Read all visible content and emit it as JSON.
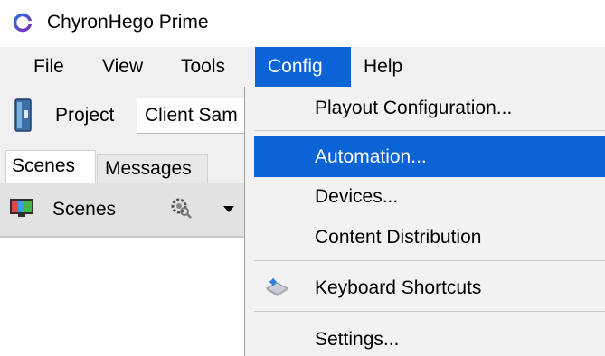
{
  "window": {
    "title": "ChyronHego Prime",
    "logo_icon": "chyronhego-logo-icon"
  },
  "menubar": {
    "items": [
      {
        "label": "File"
      },
      {
        "label": "View"
      },
      {
        "label": "Tools"
      },
      {
        "label": "Config",
        "open": true
      },
      {
        "label": "Help"
      }
    ]
  },
  "toolbar": {
    "project_label": "Project",
    "project_value": "Client Sam"
  },
  "tabs": [
    {
      "label": "Scenes",
      "active": true
    },
    {
      "label": "Messages",
      "active": false
    }
  ],
  "scenes_panel": {
    "label": "Scenes",
    "icons": [
      "scenes-icon",
      "gear-icon",
      "dropdown-arrow-icon"
    ]
  },
  "config_menu": {
    "items": [
      {
        "label": "Playout Configuration..."
      },
      {
        "label": "Automation...",
        "highlighted": true
      },
      {
        "label": "Devices..."
      },
      {
        "label": "Content Distribution"
      },
      {
        "label": "Keyboard Shortcuts",
        "icon": "keyboard-icon"
      },
      {
        "label": "Settings..."
      }
    ]
  },
  "colors": {
    "accent": "#0a64d6",
    "menubar_bg": "#f0f0f0",
    "menu_bg": "#f2f2f2"
  }
}
